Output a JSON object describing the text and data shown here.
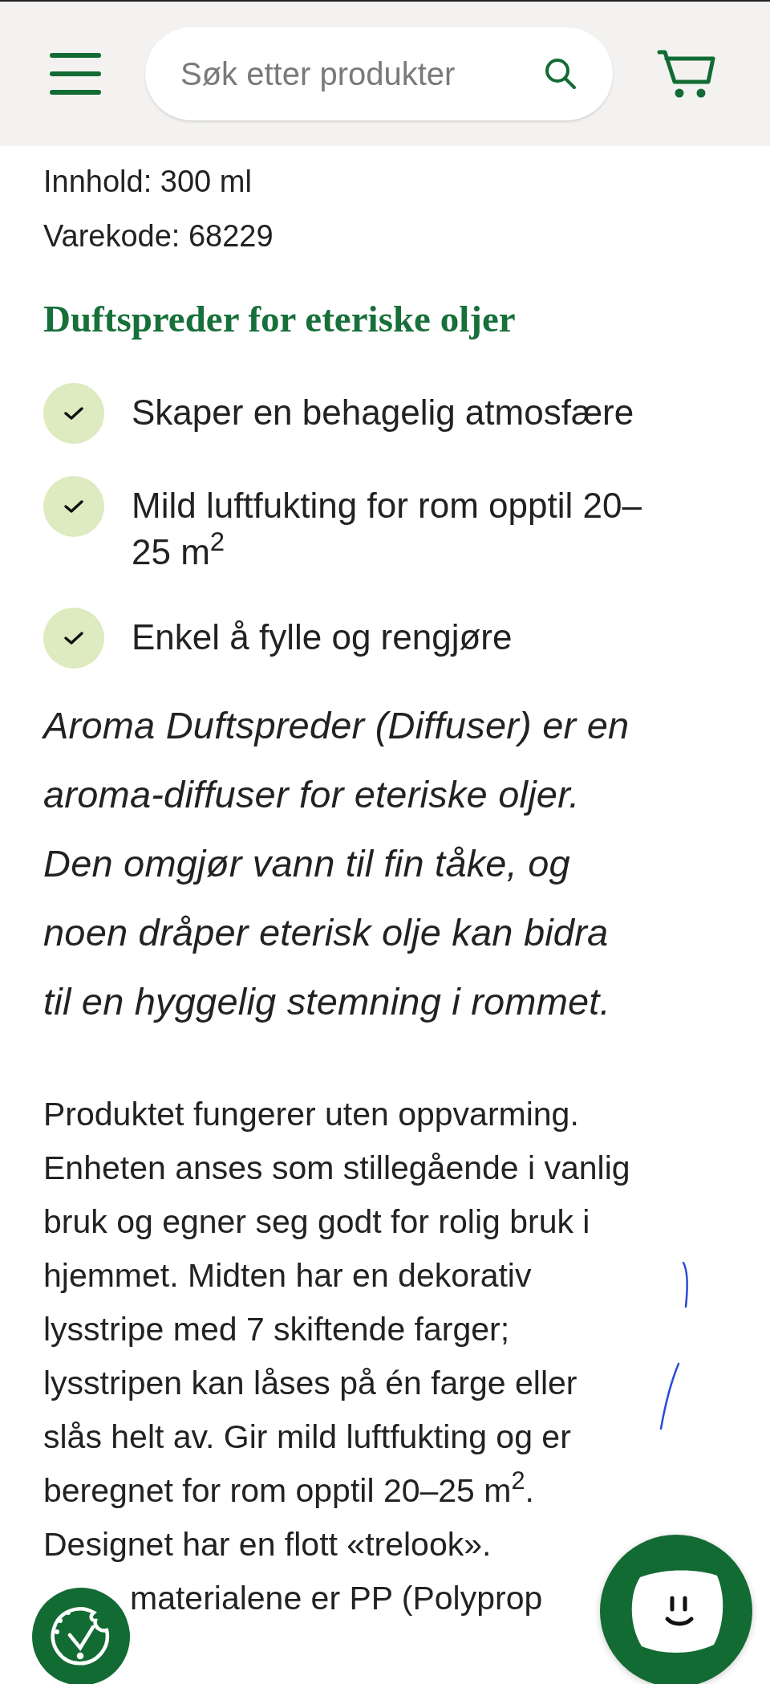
{
  "header": {
    "search": {
      "placeholder": "Søk etter produkter"
    }
  },
  "specs": [
    "Innhold: 300 ml",
    "Varekode: 68229"
  ],
  "heading": "Duftspreder for eteriske oljer",
  "features": [
    {
      "text": "Skaper en behagelig atmosfære",
      "checked": true
    },
    {
      "text": "Mild luftfukting for rom opptil 20–25 m$^{2}$",
      "checked": true
    },
    {
      "text": "Enkel å fylle og rengjøre",
      "checked": true
    }
  ],
  "lead": [
    "Aroma Duftspreder (Diffuser) er en",
    "aroma-diffuser for eteriske oljer.",
    "Den omgjør vann til fin tåke, og",
    "noen dråper eterisk olje kan bidra",
    "til en hyggelig stemning i rommet."
  ],
  "body": [
    "Produktet fungerer uten oppvarming.",
    "Enheten anses som stillegående i vanlig",
    "bruk og egner seg godt for rolig bruk i",
    "hjemmet. Midten har en dekorativ",
    "lysstripe med 7 skiftende farger;",
    "lysstripen kan låses på én farge eller",
    "slås helt av. Gir mild luftfukting og er",
    "beregnet for rom opptil 20–25 m$^{2}$.",
    "Designet har en flott «trelook»."
  ],
  "body_partial": "materialene er PP (Polyprop"
}
